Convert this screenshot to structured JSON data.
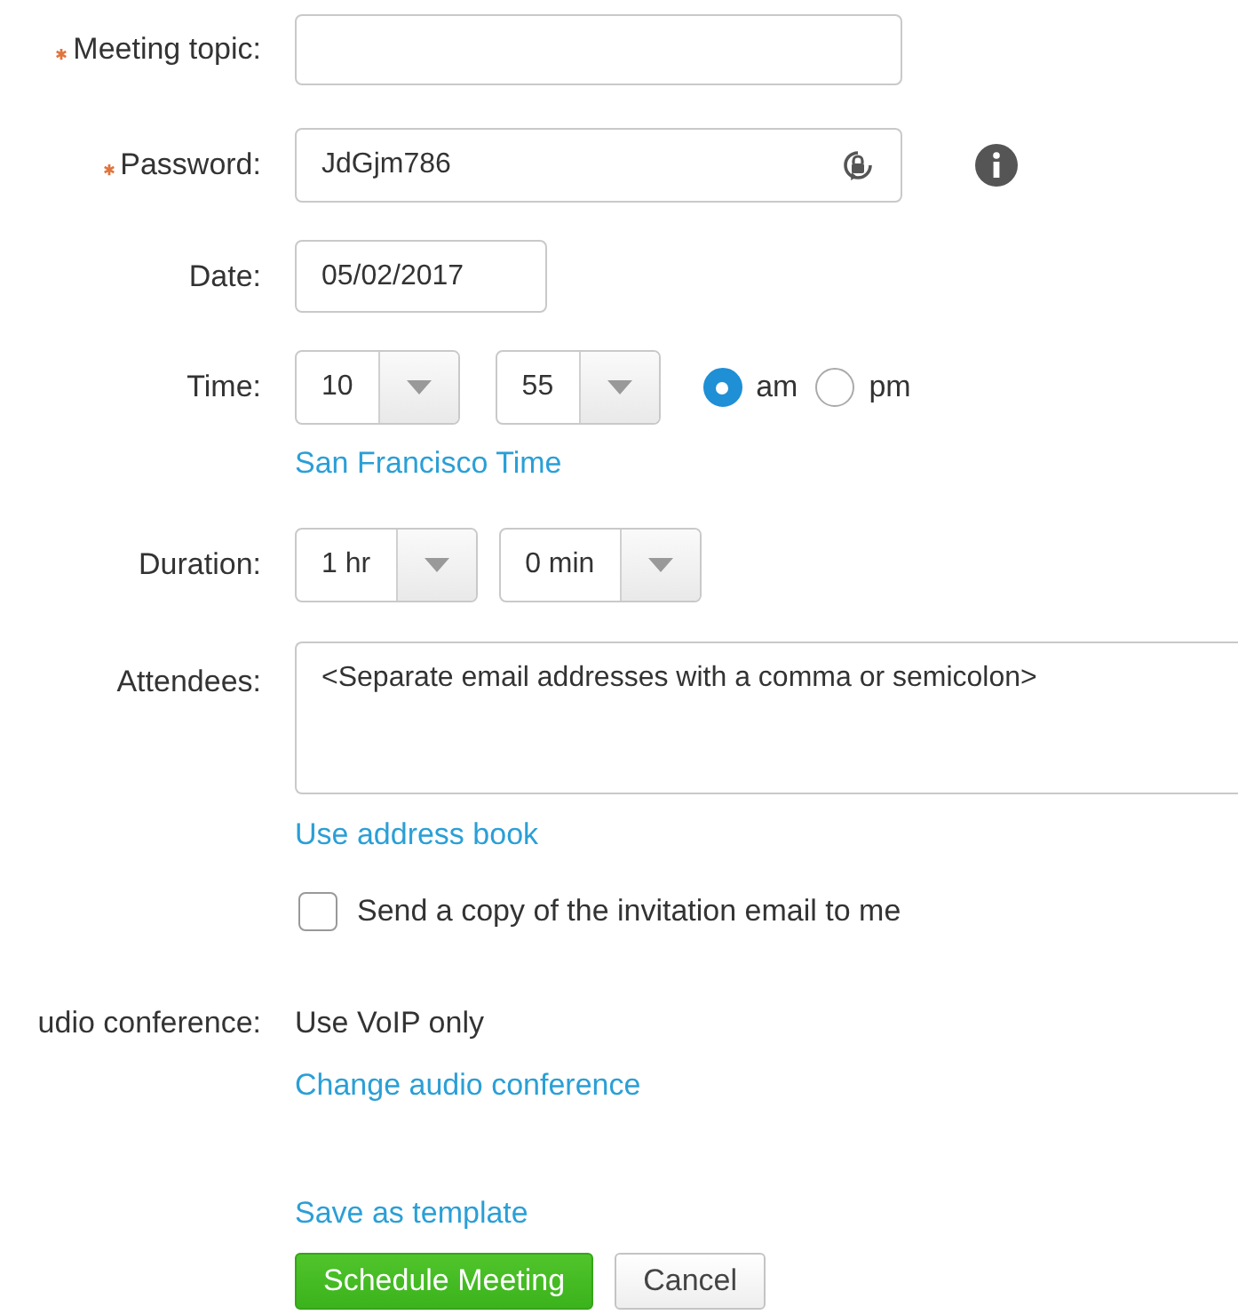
{
  "fields": [
    {
      "kind": "text",
      "label": "Meeting topic:",
      "required": true
    },
    {
      "kind": "password",
      "label": "Password:",
      "required": true,
      "value": "JdGjm786"
    },
    {
      "kind": "date",
      "label": "Date:",
      "required": false,
      "value": "05/02/2017"
    },
    {
      "kind": "time",
      "label": "Time:",
      "required": false,
      "selects": [
        {
          "value": "10"
        },
        {
          "value": "55"
        }
      ],
      "radios": [
        {
          "label": "am",
          "selected": true
        },
        {
          "label": "pm",
          "selected": false
        }
      ],
      "link": "San Francisco Time"
    },
    {
      "kind": "duration",
      "label": "Duration:",
      "required": false,
      "selects": [
        {
          "value": "1 hr"
        },
        {
          "value": "0 min"
        }
      ]
    },
    {
      "kind": "attendees",
      "label": "Attendees:",
      "required": false,
      "placeholder": "<Separate email addresses with a comma or semicolon>",
      "link": "Use address book",
      "checkbox": {
        "label": "Send a copy of the invitation email to me",
        "checked": false
      }
    },
    {
      "kind": "static",
      "label": "udio conference:",
      "required": false,
      "value": "Use VoIP only",
      "link": "Change audio conference"
    }
  ],
  "template_link": "Save as template",
  "buttons": [
    {
      "label": "Schedule Meeting",
      "kind": "primary"
    },
    {
      "label": "Cancel",
      "kind": "secondary"
    }
  ]
}
